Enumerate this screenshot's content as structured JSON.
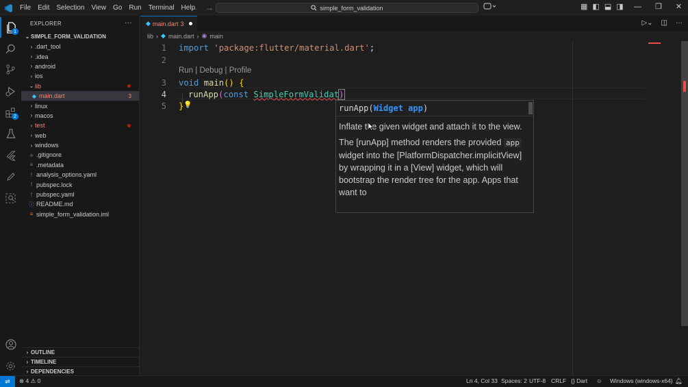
{
  "menu": [
    "File",
    "Edit",
    "Selection",
    "View",
    "Go",
    "Run",
    "Terminal",
    "Help"
  ],
  "search": {
    "text": "simple_form_validation"
  },
  "activity_badges": {
    "explorer": "1",
    "extensions": "2"
  },
  "explorer": {
    "title": "EXPLORER",
    "root": "SIMPLE_FORM_VALIDATION",
    "items": [
      {
        "label": ".dart_tool",
        "type": "folder"
      },
      {
        "label": ".idea",
        "type": "folder"
      },
      {
        "label": "android",
        "type": "folder"
      },
      {
        "label": "ios",
        "type": "folder"
      },
      {
        "label": "lib",
        "type": "folder-open"
      },
      {
        "label": "main.dart",
        "type": "dart",
        "count": "3"
      },
      {
        "label": "linux",
        "type": "folder"
      },
      {
        "label": "macos",
        "type": "folder"
      },
      {
        "label": "test",
        "type": "folder"
      },
      {
        "label": "web",
        "type": "folder"
      },
      {
        "label": "windows",
        "type": "folder"
      },
      {
        "label": ".gitignore",
        "type": "file"
      },
      {
        "label": ".metadata",
        "type": "file"
      },
      {
        "label": "analysis_options.yaml",
        "type": "yaml"
      },
      {
        "label": "pubspec.lock",
        "type": "yaml"
      },
      {
        "label": "pubspec.yaml",
        "type": "yaml"
      },
      {
        "label": "README.md",
        "type": "md"
      },
      {
        "label": "simple_form_validation.iml",
        "type": "iml"
      }
    ],
    "outline": "OUTLINE",
    "timeline": "TIMELINE",
    "dependencies": "DEPENDENCIES"
  },
  "tab": {
    "label": "main.dart",
    "problems": "3"
  },
  "breadcrumb": {
    "folder": "lib",
    "file": "main.dart",
    "symbol": "main"
  },
  "code": {
    "line_numbers": [
      "1",
      "2",
      "3",
      "4",
      "5"
    ],
    "codelens": "Run | Debug | Profile",
    "line1": {
      "kw": "import",
      "str": "'package:flutter/material.dart'",
      "end": ";"
    },
    "line3": {
      "kw": "void",
      "fn": "main",
      "rest": "() {"
    },
    "line4": {
      "fn": "runApp",
      "kw": "const",
      "cls": "SimpleFormValidat"
    },
    "line5": "}"
  },
  "hover": {
    "signature_fn": "runApp(",
    "signature_type": "Widget app",
    "signature_end": ")",
    "doc1": "Inflate the given widget and attach it to the view.",
    "doc2_a": "The [runApp] method renders the provided",
    "doc2_code": "app",
    "doc2_b": "widget into the [PlatformDispatcher.implicitView] by wrapping it in a [View] widget, which will bootstrap the render tree for the app. Apps that want to"
  },
  "status": {
    "errors": "4",
    "warnings": "0",
    "position": "Ln 4, Col 33",
    "spaces": "Spaces: 2",
    "encoding": "UTF-8",
    "eol": "CRLF",
    "language": "Dart",
    "platform": "Windows (windows-x64)"
  }
}
